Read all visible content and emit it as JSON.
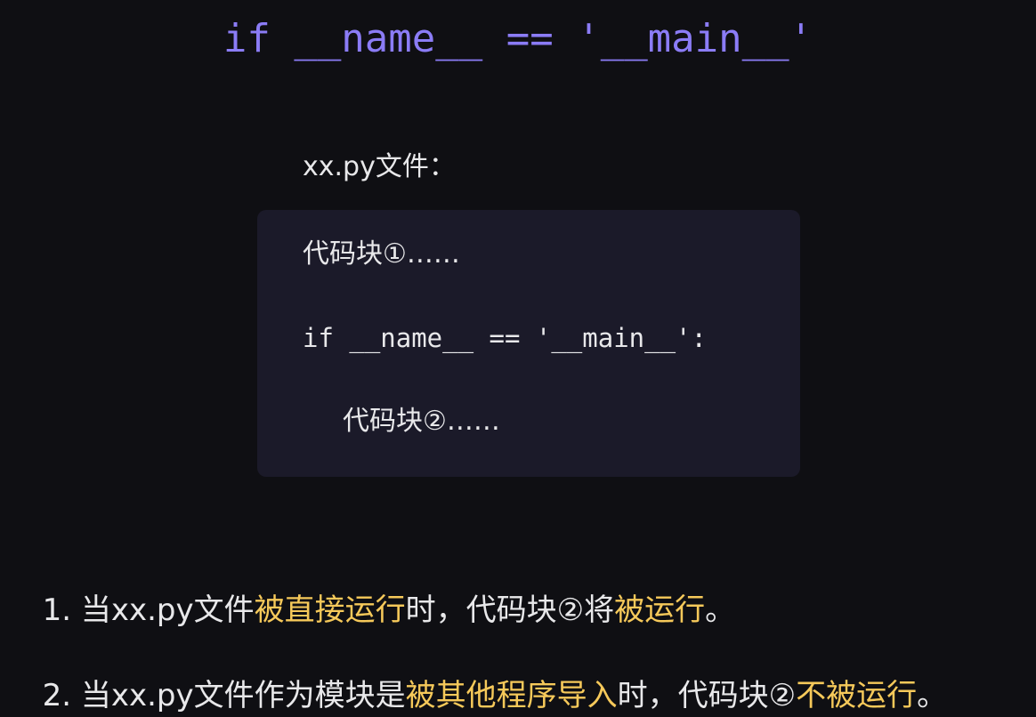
{
  "title": {
    "text": "if __name__ == '__main__'",
    "color": "#8b7cf6"
  },
  "file_label": "xx.py文件：",
  "code_block": {
    "line1": "代码块①……",
    "line2": "if __name__ == '__main__':",
    "line3": "代码块②……"
  },
  "colors": {
    "highlight": "#f6c95a",
    "code_background": "#1b1a29",
    "page_background": "#0f0f13"
  },
  "points": [
    {
      "segments": [
        {
          "text": "1. 当xx.py文件",
          "highlight": false
        },
        {
          "text": "被直接运行",
          "highlight": true
        },
        {
          "text": "时，代码块②将",
          "highlight": false
        },
        {
          "text": "被运行",
          "highlight": true
        },
        {
          "text": "。",
          "highlight": false
        }
      ]
    },
    {
      "segments": [
        {
          "text": "2. 当xx.py文件作为模块是",
          "highlight": false
        },
        {
          "text": "被其他程序导入",
          "highlight": true
        },
        {
          "text": "时，代码块②",
          "highlight": false
        },
        {
          "text": "不被运行",
          "highlight": true
        },
        {
          "text": "。",
          "highlight": false
        }
      ]
    }
  ]
}
